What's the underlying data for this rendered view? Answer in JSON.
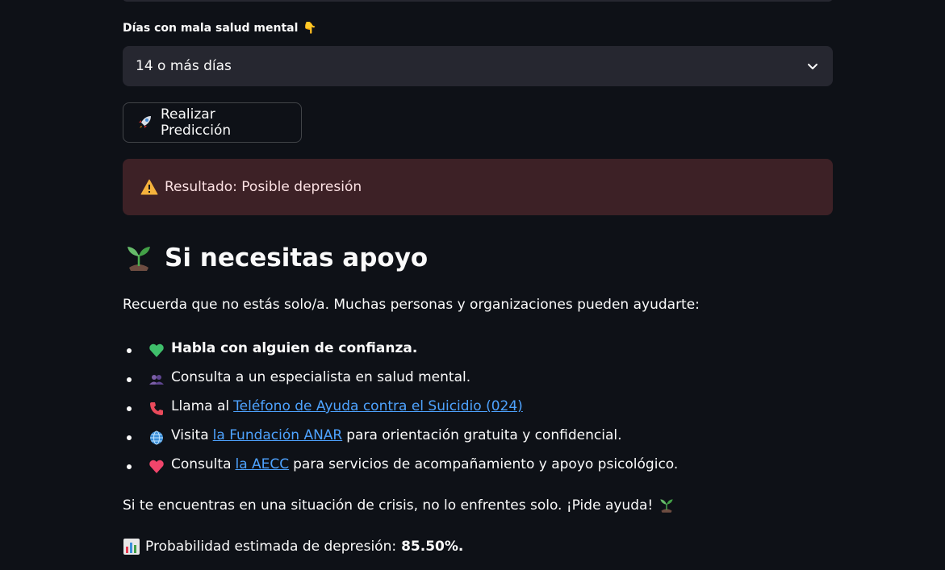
{
  "form": {
    "field_label": "Días con mala salud mental",
    "field_emoji": "👇",
    "selected_value": "14 o más días",
    "button_label": "Realizar Predicción"
  },
  "alert": {
    "text": "Resultado: Posible depresión"
  },
  "support": {
    "heading": "Si necesitas apoyo",
    "intro": "Recuerda que no estás solo/a. Muchas personas y organizaciones pueden ayudarte:",
    "items": [
      {
        "icon": "green-heart-icon",
        "text": "Habla con alguien de confianza."
      },
      {
        "icon": "people-icon",
        "text": "Consulta a un especialista en salud mental."
      },
      {
        "icon": "phone-icon",
        "prefix": "Llama al",
        "link": "Teléfono de Ayuda contra el Suicidio (024)"
      },
      {
        "icon": "globe-icon",
        "prefix": "Visita",
        "link": "la Fundación ANAR",
        "suffix": "para orientación gratuita y confidencial."
      },
      {
        "icon": "heart-icon",
        "prefix": "Consulta",
        "link": "la AECC",
        "suffix": "para servicios de acompañamiento y apoyo psicológico."
      }
    ],
    "closing": "Si te encuentras en una situación de crisis, no lo enfrentes solo. ¡Pide ayuda!",
    "probability_label": "Probabilidad estimada de depresión:",
    "probability_value": "85.50%."
  },
  "colors": {
    "background": "#0e1117",
    "surface": "#262730",
    "alert_bg": "#3d2126",
    "link": "#4ea3ff"
  }
}
